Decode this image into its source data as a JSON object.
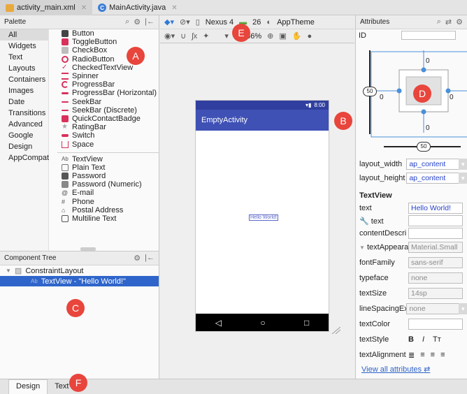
{
  "editor_tabs": [
    {
      "label": "activity_main.xml",
      "icon": "xml-file-icon"
    },
    {
      "label": "MainActivity.java",
      "icon": "java-class-icon"
    }
  ],
  "palette": {
    "title": "Palette",
    "categories": [
      "All",
      "Widgets",
      "Text",
      "Layouts",
      "Containers",
      "Images",
      "Date",
      "Transitions",
      "Advanced",
      "Google",
      "Design",
      "AppCompat"
    ],
    "widgets_group1": [
      "Button",
      "ToggleButton",
      "CheckBox",
      "RadioButton",
      "CheckedTextView",
      "Spinner",
      "ProgressBar",
      "ProgressBar (Horizontal)",
      "SeekBar",
      "SeekBar (Discrete)",
      "QuickContactBadge",
      "RatingBar",
      "Switch",
      "Space"
    ],
    "widgets_group2": [
      "TextView",
      "Plain Text",
      "Password",
      "Password (Numeric)",
      "E-mail",
      "Phone",
      "Postal Address",
      "Multiline Text"
    ]
  },
  "component_tree": {
    "title": "Component Tree",
    "root": "ConstraintLayout",
    "child": "TextView - \"Hello World!\""
  },
  "toolbar": {
    "device": "Nexus 4",
    "api": "26",
    "theme": "AppTheme",
    "zoom": "66%"
  },
  "preview": {
    "time": "8:00",
    "app_title": "EmptyActivity",
    "text": "Hello World!"
  },
  "attributes": {
    "title": "Attributes",
    "id_label": "ID",
    "margins": {
      "top": "0",
      "bottom": "0",
      "left": "0",
      "right": "0",
      "bias_v": "50",
      "bias_h": "50"
    },
    "layout_width_label": "layout_width",
    "layout_width_value": "ap_content",
    "layout_height_label": "layout_height",
    "layout_height_value": "ap_content",
    "section": "TextView",
    "rows": [
      {
        "label": "text",
        "value": "Hello World!"
      },
      {
        "label": "text",
        "value": ""
      },
      {
        "label": "contentDescri",
        "value": ""
      },
      {
        "label": "textAppeara",
        "value": "Material.Small"
      },
      {
        "label": "fontFamily",
        "value": "sans-serif"
      },
      {
        "label": "typeface",
        "value": "none"
      },
      {
        "label": "textSize",
        "value": "14sp"
      },
      {
        "label": "lineSpacingEx",
        "value": "none"
      },
      {
        "label": "textColor",
        "value": ""
      }
    ],
    "text_style_label": "textStyle",
    "text_alignment_label": "textAlignment",
    "view_all": "View all attributes"
  },
  "bottom_tabs": [
    "Design",
    "Text"
  ],
  "markers": [
    "A",
    "B",
    "C",
    "D",
    "E",
    "F"
  ],
  "colors": {
    "accent": "#3f51b5",
    "status_bar": "#303f9f",
    "selection": "#2f65ca",
    "marker": "#e8453c"
  }
}
